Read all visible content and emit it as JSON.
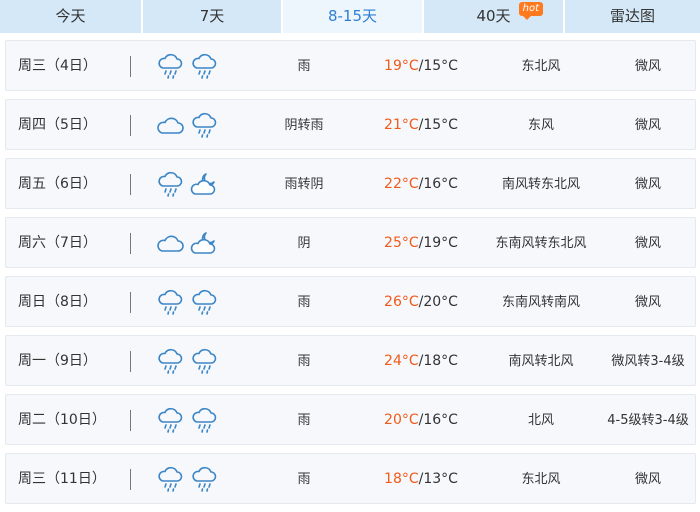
{
  "tabs": [
    {
      "label": "今天",
      "active": false
    },
    {
      "label": "7天",
      "active": false
    },
    {
      "label": "8-15天",
      "active": true
    },
    {
      "label": "40天",
      "active": false,
      "badge": "hot"
    },
    {
      "label": "雷达图",
      "active": false
    }
  ],
  "colors": {
    "accent": "#2f7fd2",
    "high_temp": "#f05a1a",
    "hot_badge": "#ff7a1f",
    "tab_bg": "#d4e8f7",
    "icon_stroke": "#3d86c6"
  },
  "days": [
    {
      "date": "周三（4日）",
      "icons": [
        "rain-icon",
        "rain-icon"
      ],
      "condition": "雨",
      "high": "19°C",
      "low": "15°C",
      "wind_dir": "东北风",
      "wind_force": "微风"
    },
    {
      "date": "周四（5日）",
      "icons": [
        "cloudy-icon",
        "rain-icon"
      ],
      "condition": "阴转雨",
      "high": "21°C",
      "low": "15°C",
      "wind_dir": "东风",
      "wind_force": "微风"
    },
    {
      "date": "周五（6日）",
      "icons": [
        "rain-icon",
        "cloudy-night-icon"
      ],
      "condition": "雨转阴",
      "high": "22°C",
      "low": "16°C",
      "wind_dir": "南风转东北风",
      "wind_force": "微风"
    },
    {
      "date": "周六（7日）",
      "icons": [
        "cloudy-icon",
        "cloudy-night-icon"
      ],
      "condition": "阴",
      "high": "25°C",
      "low": "19°C",
      "wind_dir": "东南风转东北风",
      "wind_force": "微风"
    },
    {
      "date": "周日（8日）",
      "icons": [
        "rain-icon",
        "rain-icon"
      ],
      "condition": "雨",
      "high": "26°C",
      "low": "20°C",
      "wind_dir": "东南风转南风",
      "wind_force": "微风"
    },
    {
      "date": "周一（9日）",
      "icons": [
        "rain-icon",
        "rain-icon"
      ],
      "condition": "雨",
      "high": "24°C",
      "low": "18°C",
      "wind_dir": "南风转北风",
      "wind_force": "微风转3-4级"
    },
    {
      "date": "周二（10日）",
      "icons": [
        "rain-icon",
        "rain-icon"
      ],
      "condition": "雨",
      "high": "20°C",
      "low": "16°C",
      "wind_dir": "北风",
      "wind_force": "4-5级转3-4级"
    },
    {
      "date": "周三（11日）",
      "icons": [
        "rain-icon",
        "rain-icon"
      ],
      "condition": "雨",
      "high": "18°C",
      "low": "13°C",
      "wind_dir": "东北风",
      "wind_force": "微风"
    }
  ]
}
